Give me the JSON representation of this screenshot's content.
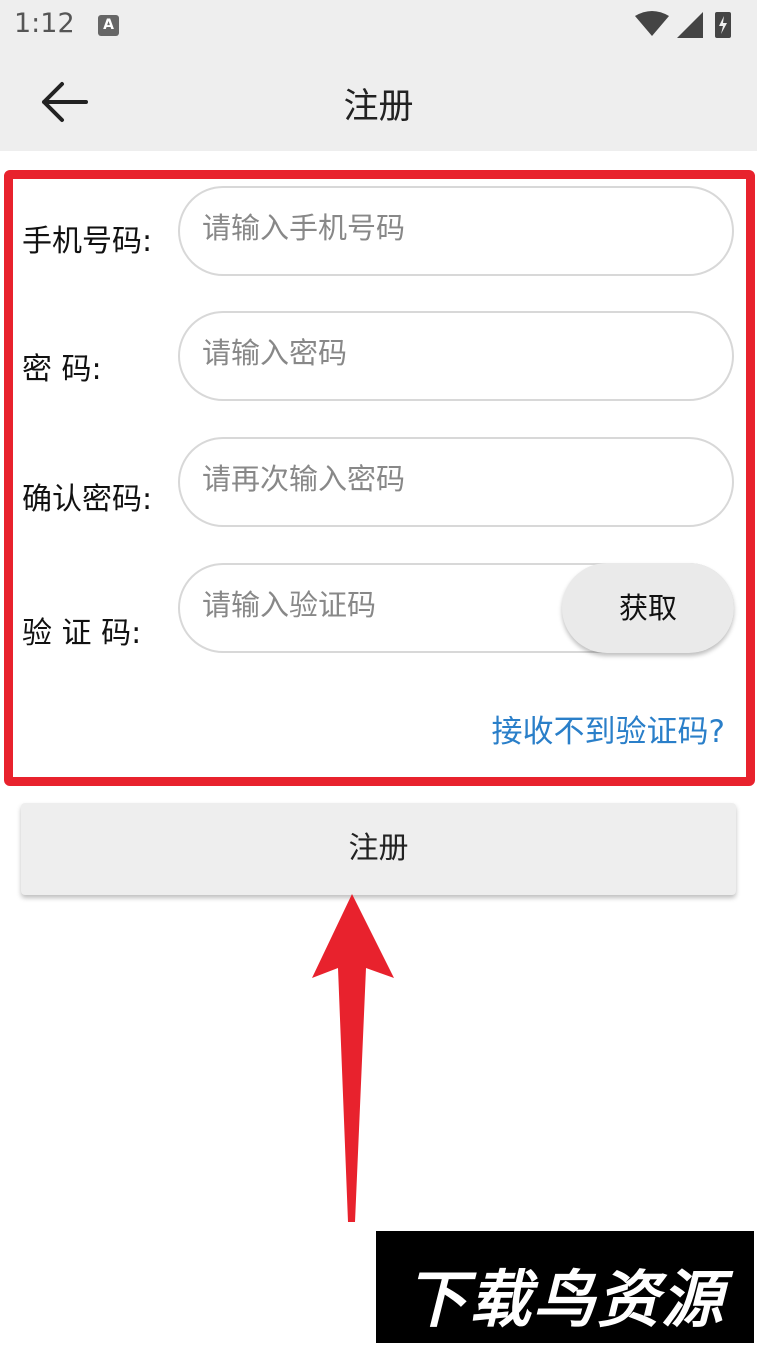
{
  "status_bar": {
    "time": "1:12",
    "notification_icon": "A"
  },
  "app_bar": {
    "title": "注册"
  },
  "form": {
    "phone": {
      "label": "手机号码:",
      "placeholder": "请输入手机号码"
    },
    "password": {
      "label": "密 码:",
      "placeholder": "请输入密码"
    },
    "confirm": {
      "label": "确认密码:",
      "placeholder": "请再次输入密码"
    },
    "code": {
      "label": "验 证 码:",
      "placeholder": "请输入验证码",
      "get_button": "获取"
    },
    "help_link": "接收不到验证码?"
  },
  "register_button": "注册",
  "watermark": "下载鸟资源",
  "colors": {
    "highlight": "#e8222d",
    "link": "#2a7fc9"
  }
}
